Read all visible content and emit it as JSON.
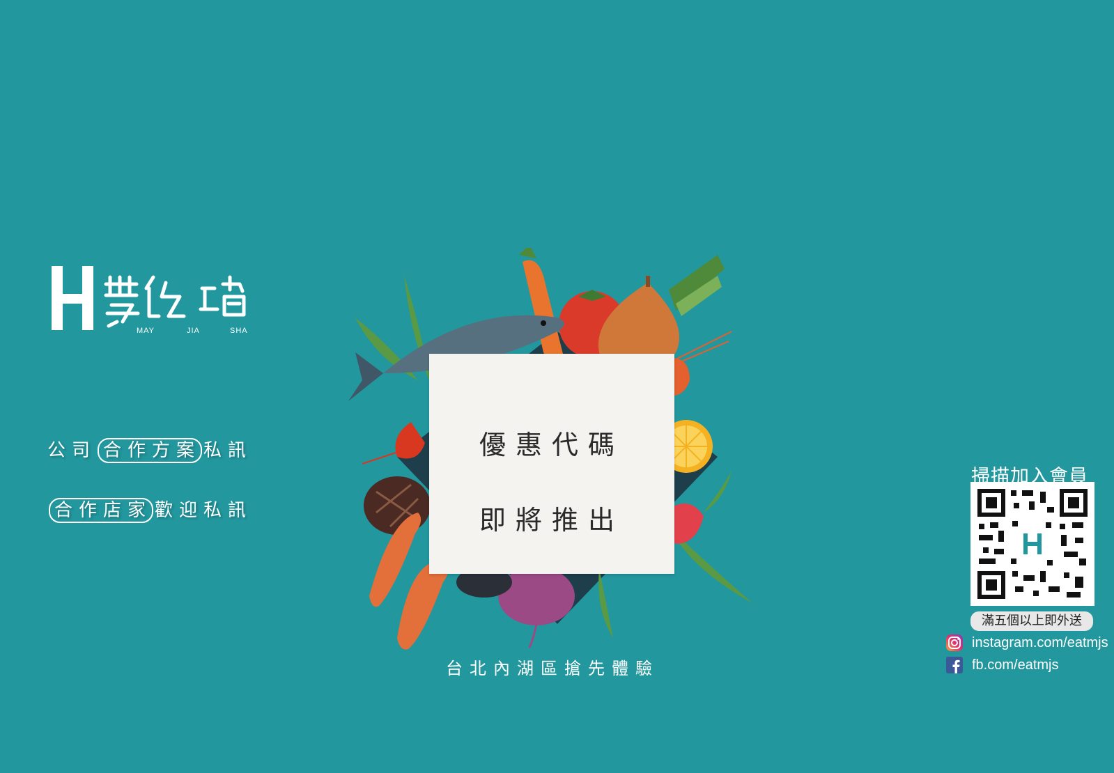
{
  "brand": {
    "name": "要吃啥",
    "roman": [
      "MAY",
      "JIA",
      "SHA"
    ]
  },
  "promos": [
    {
      "pre": "公司",
      "boxed": "合作方案",
      "post": "私訊"
    },
    {
      "pre": "",
      "boxed": "合作店家",
      "post": "歡迎私訊"
    }
  ],
  "card": {
    "line1": "優惠代碼",
    "line2": "即將推出"
  },
  "tagline": "台北內湖區搶先體驗",
  "qr": {
    "title": "掃描加入會員",
    "note": "滿五個以上即外送"
  },
  "social": {
    "instagram": "instagram.com/eatmjs",
    "facebook": "fb.com/eatmjs"
  },
  "colors": {
    "background": "#22979e",
    "card": "#f5f3ef"
  }
}
